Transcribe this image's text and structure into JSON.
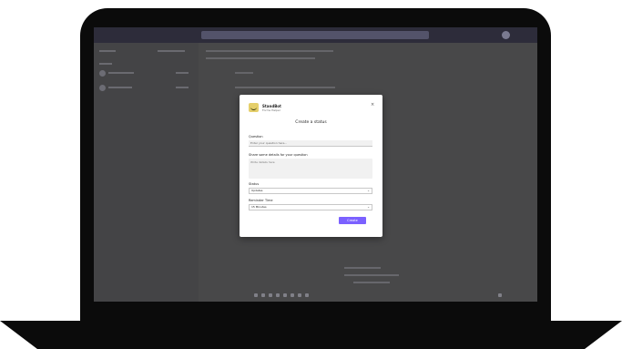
{
  "dialog": {
    "app_name": "StandBot",
    "app_subtitle": "Forms Helper",
    "title": "Create a status",
    "fields": {
      "question_label": "Question",
      "question_value": "Enter your question here...",
      "details_label": "Share some details for your question",
      "details_placeholder": "Write details here",
      "status_label": "Status",
      "status_value": "Updates",
      "reminder_label": "Reminder Time",
      "reminder_value": "15 Minutes"
    },
    "create_label": "Create",
    "close_glyph": "×",
    "chevron_glyph": "⌄"
  },
  "colors": {
    "accent": "#7b61ff",
    "logo": "#e5cf6b",
    "app_bar": "#2d2c3a"
  },
  "icons": {
    "close": "close-icon",
    "dropdown": "chevron-down-icon",
    "logo": "app-logo-icon"
  }
}
